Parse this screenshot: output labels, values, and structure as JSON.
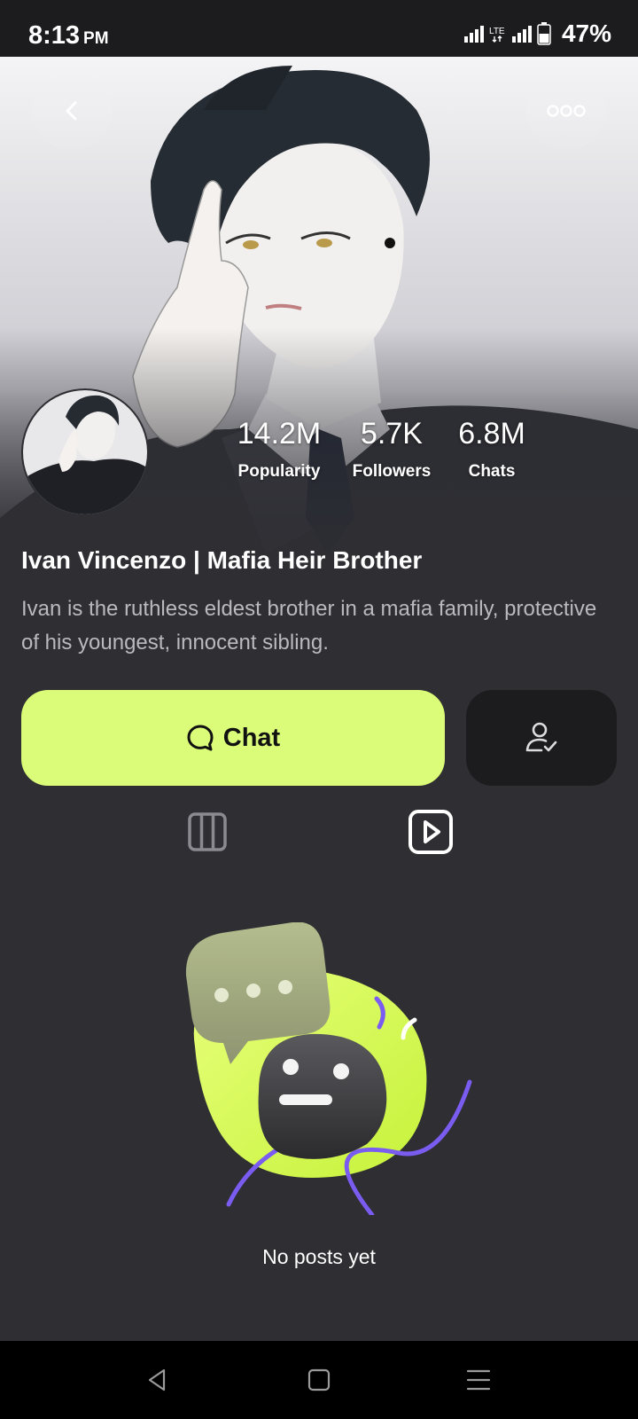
{
  "status_bar": {
    "time": "8:13",
    "ampm": "PM",
    "battery": "47%",
    "icons": [
      "signal-icon",
      "lte-icon",
      "signal-icon",
      "battery-icon"
    ]
  },
  "header": {
    "back_icon": "chevron-left-icon",
    "more_icon": "more-dots-icon"
  },
  "profile": {
    "name": "Ivan Vincenzo | Mafia Heir Brother",
    "description": "Ivan is the ruthless eldest brother in a mafia family, protective of his youngest, innocent sibling.",
    "stats": [
      {
        "value": "14.2M",
        "label": "Popularity"
      },
      {
        "value": "5.7K",
        "label": "Followers"
      },
      {
        "value": "6.8M",
        "label": "Chats"
      }
    ]
  },
  "actions": {
    "chat_label": "Chat",
    "chat_icon": "chat-bubble-icon",
    "follow_icon": "user-check-icon",
    "accent_color": "#dafc78"
  },
  "tabs": [
    {
      "icon": "columns-grid-icon",
      "active": false
    },
    {
      "icon": "play-video-icon",
      "active": true
    }
  ],
  "empty_state": {
    "text": "No posts yet"
  },
  "nav": {
    "icons": [
      "back-triangle-icon",
      "home-square-icon",
      "recents-menu-icon"
    ]
  }
}
